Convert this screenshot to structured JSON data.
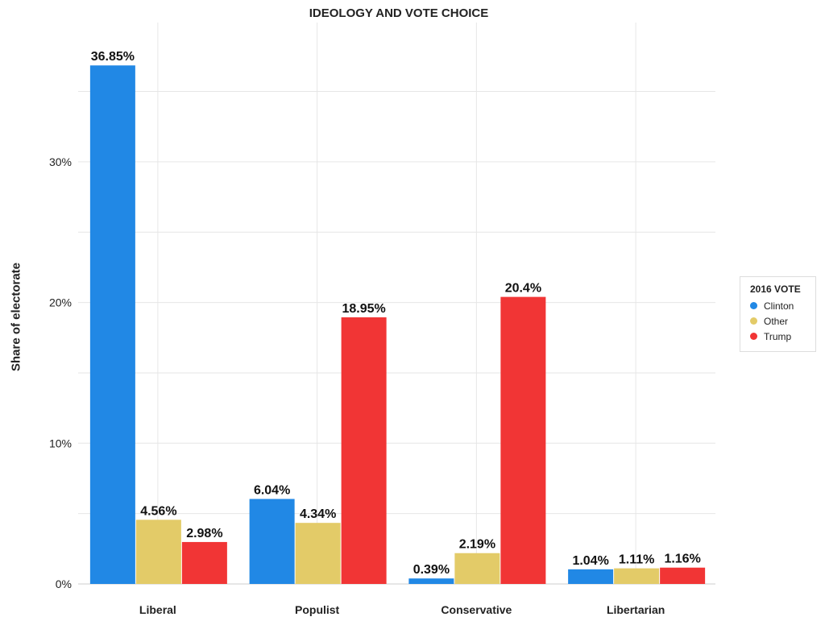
{
  "chart_data": {
    "type": "bar",
    "title": "IDEOLOGY AND VOTE CHOICE",
    "ylabel": "Share of electorate",
    "xlabel": "",
    "categories": [
      "Liberal",
      "Populist",
      "Conservative",
      "Libertarian"
    ],
    "series": [
      {
        "name": "Clinton",
        "color": "#2188e5",
        "values": [
          36.85,
          6.04,
          0.39,
          1.04
        ],
        "labels": [
          "36.85%",
          "6.04%",
          "0.39%",
          "1.04%"
        ]
      },
      {
        "name": "Other",
        "color": "#e3cb68",
        "values": [
          4.56,
          4.34,
          2.19,
          1.11
        ],
        "labels": [
          "4.56%",
          "4.34%",
          "2.19%",
          "1.11%"
        ]
      },
      {
        "name": "Trump",
        "color": "#f13535",
        "values": [
          2.98,
          18.95,
          20.4,
          1.16
        ],
        "labels": [
          "2.98%",
          "18.95%",
          "20.4%",
          "1.16%"
        ]
      }
    ],
    "ylim": [
      0,
      40
    ],
    "yticks": [
      0,
      10,
      20,
      30
    ],
    "ytick_labels": [
      "0%",
      "10%",
      "20%",
      "30%"
    ],
    "grid": true,
    "legend": {
      "title": "2016 VOTE",
      "placement": "right"
    }
  }
}
